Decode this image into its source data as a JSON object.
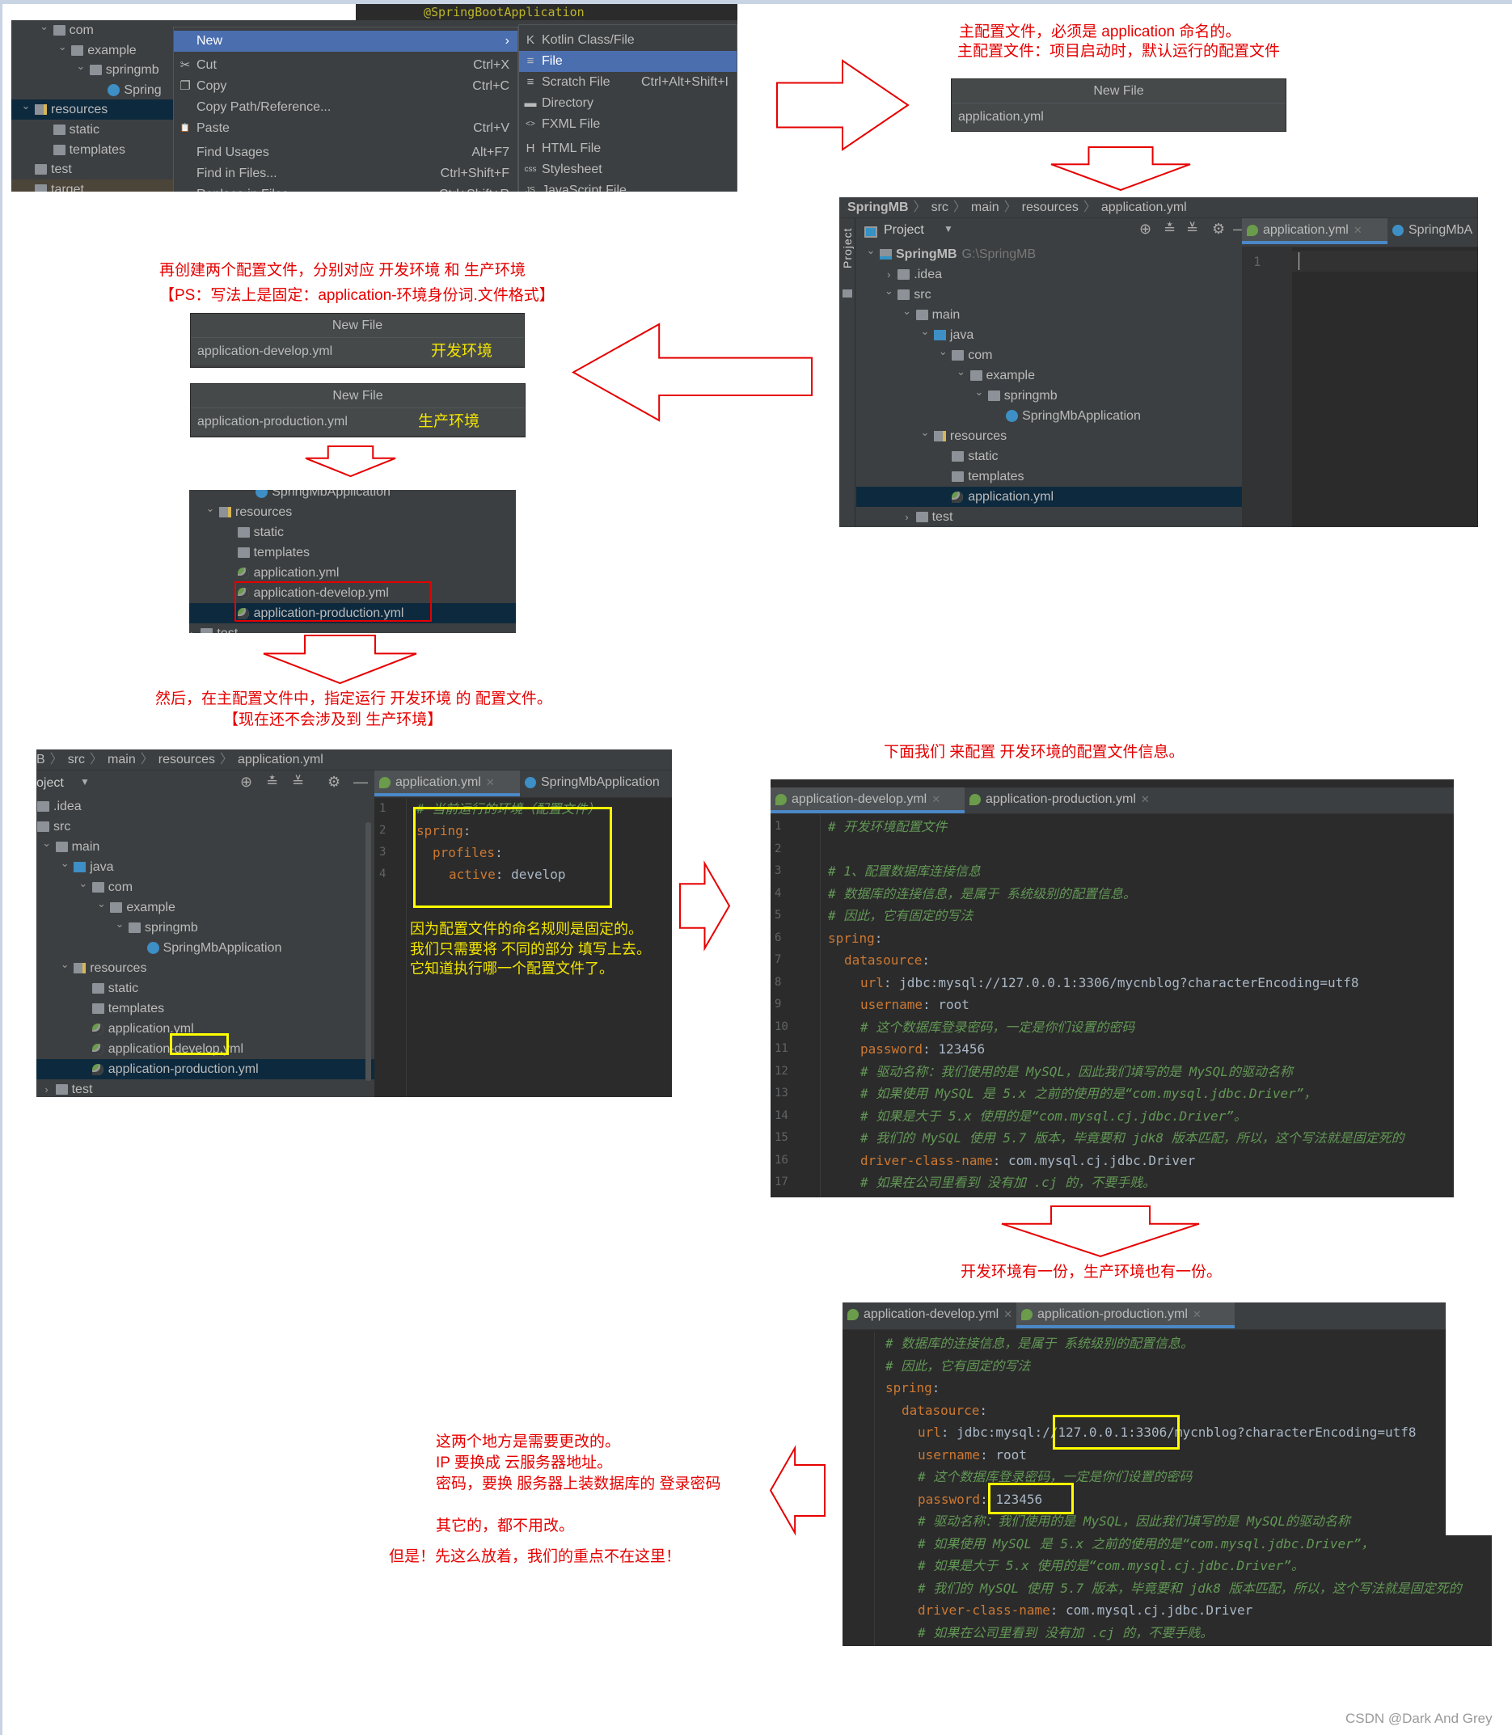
{
  "colors": {
    "annotation_red": "#e60000",
    "highlight_yellow": "#ffff00",
    "ide_bg": "#3c3f41",
    "editor_bg": "#2b2b2b",
    "selection": "#4b6eaf"
  },
  "step1": {
    "tree": [
      {
        "label": "com",
        "depth": 1,
        "chev": "down",
        "icon": "folder"
      },
      {
        "label": "example",
        "depth": 2,
        "chev": "down",
        "icon": "folder"
      },
      {
        "label": "springmb",
        "depth": 3,
        "chev": "down",
        "icon": "folder"
      },
      {
        "label": "Spring",
        "depth": 4,
        "icon": "class"
      },
      {
        "label": "resources",
        "depth": 0,
        "chev": "down",
        "icon": "res",
        "sel": true
      },
      {
        "label": "static",
        "depth": 1,
        "icon": "folder"
      },
      {
        "label": "templates",
        "depth": 1,
        "icon": "folder"
      },
      {
        "label": "test",
        "depth": 0,
        "icon": "folder"
      },
      {
        "label": "target",
        "depth": 0,
        "icon": "folder",
        "hl": true
      }
    ],
    "editor_fragment": "@SpringBootApplication",
    "menu": [
      {
        "label": "New",
        "arrow": "›",
        "on": true
      },
      {
        "label": "Cut",
        "shortcut": "Ctrl+X",
        "icon": "✂"
      },
      {
        "label": "Copy",
        "shortcut": "Ctrl+C",
        "icon": "❐"
      },
      {
        "label": "Copy Path/Reference..."
      },
      {
        "label": "Paste",
        "shortcut": "Ctrl+V",
        "icon": "📋"
      },
      {
        "label": "Find Usages",
        "shortcut": "Alt+F7"
      },
      {
        "label": "Find in Files...",
        "shortcut": "Ctrl+Shift+F"
      },
      {
        "label": "Replace in Files...",
        "shortcut": "Ctrl+Shift+R"
      }
    ],
    "submenu": [
      {
        "label": "Kotlin Class/File",
        "icon": "K"
      },
      {
        "label": "File",
        "icon": "≡",
        "on": true
      },
      {
        "label": "Scratch File",
        "shortcut": "Ctrl+Alt+Shift+I",
        "icon": "≡"
      },
      {
        "label": "Directory",
        "icon": "▬"
      },
      {
        "label": "FXML File",
        "icon": "<>"
      },
      {
        "label": "HTML File",
        "icon": "H"
      },
      {
        "label": "Stylesheet",
        "icon": "css"
      },
      {
        "label": "JavaScript File",
        "icon": "JS"
      }
    ]
  },
  "note1": {
    "line1": "主配置文件，必须是 application 命名的。",
    "line2": "主配置文件：项目启动时，默认运行的配置文件"
  },
  "dialog_main": {
    "title": "New File",
    "value": "application.yml"
  },
  "ide1": {
    "breadcrumb": [
      "SpringMB",
      "src",
      "main",
      "resources",
      "application.yml"
    ],
    "side_label": "Project",
    "view_label": "Project",
    "tree": [
      {
        "label": "SpringMB",
        "hint": "G:\\SpringMB",
        "depth": 0,
        "chev": "down",
        "icon": "module",
        "bold": true
      },
      {
        "label": ".idea",
        "depth": 1,
        "chev": "right",
        "icon": "folder"
      },
      {
        "label": "src",
        "depth": 1,
        "chev": "down",
        "icon": "folder"
      },
      {
        "label": "main",
        "depth": 2,
        "chev": "down",
        "icon": "folder"
      },
      {
        "label": "java",
        "depth": 3,
        "chev": "down",
        "icon": "javaf"
      },
      {
        "label": "com",
        "depth": 4,
        "chev": "down",
        "icon": "folder"
      },
      {
        "label": "example",
        "depth": 5,
        "chev": "down",
        "icon": "folder"
      },
      {
        "label": "springmb",
        "depth": 6,
        "chev": "down",
        "icon": "folder"
      },
      {
        "label": "SpringMbApplication",
        "depth": 7,
        "icon": "class"
      },
      {
        "label": "resources",
        "depth": 3,
        "chev": "down",
        "icon": "res"
      },
      {
        "label": "static",
        "depth": 4,
        "icon": "folder"
      },
      {
        "label": "templates",
        "depth": 4,
        "icon": "folder"
      },
      {
        "label": "application.yml",
        "depth": 4,
        "icon": "yml",
        "sel": true
      },
      {
        "label": "test",
        "depth": 2,
        "chev": "right",
        "icon": "folder"
      }
    ],
    "tabs": [
      {
        "label": "application.yml",
        "active": true,
        "icon": "yml"
      },
      {
        "label": "SpringMbA",
        "icon": "class"
      }
    ],
    "line_numbers": [
      "1"
    ]
  },
  "note2": {
    "line1": "再创建两个配置文件，分别对应 开发环境 和 生产环境",
    "line2": "【PS：写法上是固定：application-环境身份词.文件格式】"
  },
  "dialog_dev": {
    "title": "New File",
    "value": "application-develop.yml",
    "tag": "开发环境"
  },
  "dialog_prod": {
    "title": "New File",
    "value": "application-production.yml",
    "tag": "生产环境"
  },
  "tree2": [
    {
      "label": "SpringMbApplication",
      "depth": 2,
      "icon": "class"
    },
    {
      "label": "resources",
      "depth": 0,
      "chev": "down",
      "icon": "res"
    },
    {
      "label": "static",
      "depth": 1,
      "icon": "folder"
    },
    {
      "label": "templates",
      "depth": 1,
      "icon": "folder"
    },
    {
      "label": "application.yml",
      "depth": 1,
      "icon": "yml"
    },
    {
      "label": "application-develop.yml",
      "depth": 1,
      "icon": "yml"
    },
    {
      "label": "application-production.yml",
      "depth": 1,
      "icon": "yml",
      "sel": true
    },
    {
      "label": "test",
      "depth": -1,
      "chev": "right",
      "icon": "folder"
    }
  ],
  "note3": {
    "line1": "然后，在主配置文件中，指定运行 开发环境 的 配置文件。",
    "line2": "【现在还不会涉及到 生产环境】"
  },
  "ide2": {
    "breadcrumb": [
      "B",
      "src",
      "main",
      "resources",
      "application.yml"
    ],
    "view_label": "oject",
    "tree": [
      {
        "label": ".idea",
        "depth": 0,
        "icon": "folder"
      },
      {
        "label": "src",
        "depth": 0,
        "icon": "folder"
      },
      {
        "label": "main",
        "depth": 1,
        "chev": "down",
        "icon": "folder"
      },
      {
        "label": "java",
        "depth": 2,
        "chev": "down",
        "icon": "javaf"
      },
      {
        "label": "com",
        "depth": 3,
        "chev": "down",
        "icon": "folder"
      },
      {
        "label": "example",
        "depth": 4,
        "chev": "down",
        "icon": "folder"
      },
      {
        "label": "springmb",
        "depth": 5,
        "chev": "down",
        "icon": "folder"
      },
      {
        "label": "SpringMbApplication",
        "depth": 6,
        "icon": "class"
      },
      {
        "label": "resources",
        "depth": 2,
        "chev": "down",
        "icon": "res"
      },
      {
        "label": "static",
        "depth": 3,
        "icon": "folder"
      },
      {
        "label": "templates",
        "depth": 3,
        "icon": "folder"
      },
      {
        "label": "application.yml",
        "depth": 3,
        "icon": "yml"
      },
      {
        "label": "application-develop.yml",
        "depth": 3,
        "icon": "yml"
      },
      {
        "label": "application-production.yml",
        "depth": 3,
        "icon": "yml",
        "sel": true
      },
      {
        "label": "test",
        "depth": 1,
        "chev": "right",
        "icon": "folder"
      }
    ],
    "tabs": [
      {
        "label": "application.yml",
        "active": true,
        "icon": "yml"
      },
      {
        "label": "SpringMbApplication",
        "icon": "class"
      }
    ],
    "code": [
      {
        "n": "1",
        "indent": 0,
        "toks": [
          {
            "k": "comment",
            "t": "#  当前运行的环境（配置文件）"
          }
        ]
      },
      {
        "n": "2",
        "indent": 0,
        "toks": [
          {
            "k": "key",
            "t": "spring"
          },
          {
            "k": "punct",
            "t": ":"
          }
        ]
      },
      {
        "n": "3",
        "indent": 1,
        "toks": [
          {
            "k": "key",
            "t": "profiles"
          },
          {
            "k": "punct",
            "t": ":"
          }
        ]
      },
      {
        "n": "4",
        "indent": 2,
        "toks": [
          {
            "k": "key",
            "t": "active"
          },
          {
            "k": "punct",
            "t": ": "
          },
          {
            "k": "val",
            "t": "develop"
          }
        ]
      }
    ],
    "note": [
      "因为配置文件的命名规则是固定的。",
      "我们只需要将 不同的部分 填写上去。",
      "它知道执行哪一个配置文件了。"
    ]
  },
  "note4": "下面我们 来配置 开发环境的配置文件信息。",
  "dev_editor": {
    "tabs": [
      {
        "label": "application-develop.yml",
        "active": true,
        "icon": "yml"
      },
      {
        "label": "application-production.yml",
        "icon": "yml"
      }
    ],
    "code": [
      {
        "n": "1",
        "indent": 0,
        "toks": [
          {
            "k": "comment",
            "t": "# 开发环境配置文件"
          }
        ]
      },
      {
        "n": "2",
        "indent": 0,
        "toks": []
      },
      {
        "n": "3",
        "indent": 0,
        "toks": [
          {
            "k": "comment",
            "t": "# 1、配置数据库连接信息"
          }
        ]
      },
      {
        "n": "4",
        "indent": 0,
        "toks": [
          {
            "k": "comment",
            "t": "# 数据库的连接信息，是属于 系统级别的配置信息。"
          }
        ]
      },
      {
        "n": "5",
        "indent": 0,
        "toks": [
          {
            "k": "comment",
            "t": "# 因此，它有固定的写法"
          }
        ]
      },
      {
        "n": "6",
        "indent": 0,
        "toks": [
          {
            "k": "key",
            "t": "spring"
          },
          {
            "k": "punct",
            "t": ":"
          }
        ]
      },
      {
        "n": "7",
        "indent": 1,
        "toks": [
          {
            "k": "key",
            "t": "datasource"
          },
          {
            "k": "punct",
            "t": ":"
          }
        ]
      },
      {
        "n": "8",
        "indent": 2,
        "toks": [
          {
            "k": "key",
            "t": "url"
          },
          {
            "k": "punct",
            "t": ": "
          },
          {
            "k": "val",
            "t": "jdbc:mysql://127.0.0.1:3306/mycnblog?characterEncoding=utf8"
          }
        ]
      },
      {
        "n": "9",
        "indent": 2,
        "toks": [
          {
            "k": "key",
            "t": "username"
          },
          {
            "k": "punct",
            "t": ": "
          },
          {
            "k": "val",
            "t": "root"
          }
        ]
      },
      {
        "n": "10",
        "indent": 2,
        "toks": [
          {
            "k": "comment",
            "t": "# 这个数据库登录密码，一定是你们设置的密码"
          }
        ]
      },
      {
        "n": "11",
        "indent": 2,
        "toks": [
          {
            "k": "key",
            "t": "password"
          },
          {
            "k": "punct",
            "t": ": "
          },
          {
            "k": "val",
            "t": "123456"
          }
        ]
      },
      {
        "n": "12",
        "indent": 2,
        "toks": [
          {
            "k": "comment",
            "t": "# 驱动名称：我们使用的是 MySQL，因此我们填写的是 MySQL的驱动名称"
          }
        ]
      },
      {
        "n": "13",
        "indent": 2,
        "toks": [
          {
            "k": "comment",
            "t": "# 如果使用 MySQL 是 5.x 之前的使用的是“com.mysql.jdbc.Driver”，"
          }
        ]
      },
      {
        "n": "14",
        "indent": 2,
        "toks": [
          {
            "k": "comment",
            "t": "# 如果是大于 5.x 使用的是“com.mysql.cj.jdbc.Driver”。"
          }
        ]
      },
      {
        "n": "15",
        "indent": 2,
        "toks": [
          {
            "k": "comment",
            "t": "# 我们的 MySQL 使用 5.7 版本，毕竟要和 jdk8 版本匹配，所以，这个写法就是固定死的"
          }
        ]
      },
      {
        "n": "16",
        "indent": 2,
        "toks": [
          {
            "k": "key",
            "t": "driver-class-name"
          },
          {
            "k": "punct",
            "t": ": "
          },
          {
            "k": "val",
            "t": "com.mysql.cj.jdbc.Driver"
          }
        ]
      },
      {
        "n": "17",
        "indent": 2,
        "toks": [
          {
            "k": "comment",
            "t": "# 如果在公司里看到 没有加 .cj 的，不要手贱。"
          }
        ]
      }
    ]
  },
  "note5": "开发环境有一份，生产环境也有一份。",
  "prod_editor": {
    "tabs": [
      {
        "label": "application-develop.yml",
        "icon": "yml"
      },
      {
        "label": "application-production.yml",
        "active": true,
        "icon": "yml"
      }
    ],
    "code": [
      {
        "indent": 0,
        "toks": [
          {
            "k": "comment",
            "t": "# 数据库的连接信息，是属于 系统级别的配置信息。"
          }
        ]
      },
      {
        "indent": 0,
        "toks": [
          {
            "k": "comment",
            "t": "# 因此，它有固定的写法"
          }
        ]
      },
      {
        "indent": 0,
        "toks": [
          {
            "k": "key",
            "t": "spring"
          },
          {
            "k": "punct",
            "t": ":"
          }
        ]
      },
      {
        "indent": 1,
        "toks": [
          {
            "k": "key",
            "t": "datasource"
          },
          {
            "k": "punct",
            "t": ":"
          }
        ]
      },
      {
        "indent": 2,
        "toks": [
          {
            "k": "key",
            "t": "url"
          },
          {
            "k": "punct",
            "t": ": "
          },
          {
            "k": "val",
            "t": "jdbc:mysql://127.0.0.1:3306/mycnblog?characterEncoding=utf8"
          }
        ]
      },
      {
        "indent": 2,
        "toks": [
          {
            "k": "key",
            "t": "username"
          },
          {
            "k": "punct",
            "t": ": "
          },
          {
            "k": "val",
            "t": "root"
          }
        ]
      },
      {
        "indent": 2,
        "toks": [
          {
            "k": "comment",
            "t": "# 这个数据库登录密码，一定是你们设置的密码"
          }
        ]
      },
      {
        "indent": 2,
        "toks": [
          {
            "k": "key",
            "t": "password"
          },
          {
            "k": "punct",
            "t": ": "
          },
          {
            "k": "val",
            "t": "123456"
          }
        ]
      },
      {
        "indent": 2,
        "toks": [
          {
            "k": "comment",
            "t": "# 驱动名称：我们使用的是 MySQL，因此我们填写的是 MySQL的驱动名称"
          }
        ]
      },
      {
        "indent": 2,
        "toks": [
          {
            "k": "comment",
            "t": "# 如果使用 MySQL 是 5.x 之前的使用的是“com.mysql.jdbc.Driver”，"
          }
        ]
      },
      {
        "indent": 2,
        "toks": [
          {
            "k": "comment",
            "t": "# 如果是大于 5.x 使用的是“com.mysql.cj.jdbc.Driver”。"
          }
        ]
      },
      {
        "indent": 2,
        "toks": [
          {
            "k": "comment",
            "t": "# 我们的 MySQL 使用 5.7 版本，毕竟要和 jdk8 版本匹配，所以，这个写法就是固定死的"
          }
        ]
      },
      {
        "indent": 2,
        "toks": [
          {
            "k": "key",
            "t": "driver-class-name"
          },
          {
            "k": "punct",
            "t": ": "
          },
          {
            "k": "val",
            "t": "com.mysql.cj.jdbc.Driver"
          }
        ]
      },
      {
        "indent": 2,
        "toks": [
          {
            "k": "comment",
            "t": "# 如果在公司里看到 没有加 .cj 的，不要手贱。"
          }
        ]
      }
    ]
  },
  "note6": {
    "lines": [
      "这两个地方是需要更改的。",
      "IP 要换成 云服务器地址。",
      "密码，要换 服务器上装数据库的 登录密码"
    ],
    "line4": "其它的，都不用改。",
    "line5": "但是！先这么放着，我们的重点不在这里！"
  },
  "watermark": "CSDN @Dark And Grey"
}
